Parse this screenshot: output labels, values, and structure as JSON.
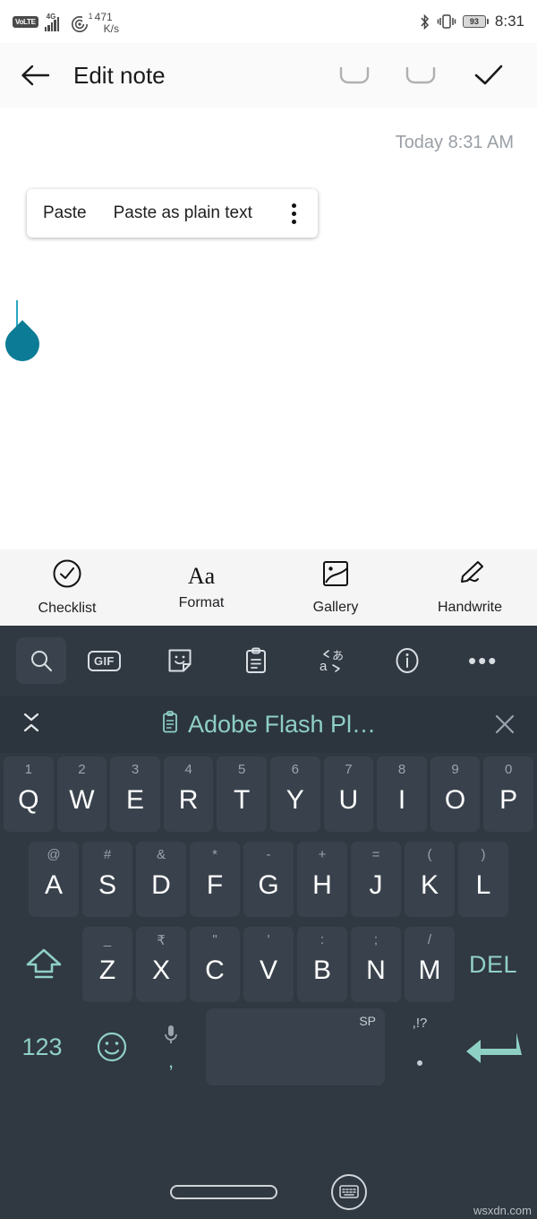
{
  "statusbar": {
    "volte": "VoLTE",
    "network_gen": "4G",
    "wifi_count": "1",
    "data_rate_value": "471",
    "data_rate_unit": "K/s",
    "battery_percent": "93",
    "clock": "8:31",
    "icons": [
      "volte-icon",
      "signal-bars-icon",
      "hotspot-icon",
      "bluetooth-icon",
      "vibrate-icon",
      "battery-icon"
    ]
  },
  "appbar": {
    "back_icon": "back-arrow-icon",
    "title": "Edit note",
    "undo_icon": "undo-icon",
    "redo_icon": "redo-icon",
    "done_icon": "checkmark-icon"
  },
  "note": {
    "timestamp": "Today 8:31 AM",
    "body_text": "",
    "paste_menu": {
      "paste_label": "Paste",
      "paste_plain_label": "Paste as plain text",
      "overflow_icon": "more-vertical-icon"
    },
    "cursor_handle_color": "#0c7b96"
  },
  "format_toolbar": {
    "items": [
      {
        "label": "Checklist",
        "icon": "checklist-circle-icon"
      },
      {
        "label": "Format",
        "icon": "format-aa-icon",
        "glyph": "Aa"
      },
      {
        "label": "Gallery",
        "icon": "gallery-image-icon"
      },
      {
        "label": "Handwrite",
        "icon": "handwrite-pen-icon"
      }
    ]
  },
  "keyboard": {
    "background": "#303841",
    "accent": "#8fd0c4",
    "toolbar": [
      {
        "name": "search-icon",
        "selected": true
      },
      {
        "name": "gif-icon",
        "label": "GIF"
      },
      {
        "name": "sticker-icon"
      },
      {
        "name": "clipboard-icon"
      },
      {
        "name": "translate-icon"
      },
      {
        "name": "info-icon"
      },
      {
        "name": "more-horizontal-icon",
        "label": "•••"
      }
    ],
    "suggestion": {
      "collapse_icon": "collapse-chevrons-icon",
      "clip_icon": "clipboard-icon",
      "text": "Adobe Flash Pl…",
      "close_icon": "close-x-icon"
    },
    "row1": [
      {
        "key": "Q",
        "hint": "1"
      },
      {
        "key": "W",
        "hint": "2"
      },
      {
        "key": "E",
        "hint": "3"
      },
      {
        "key": "R",
        "hint": "4"
      },
      {
        "key": "T",
        "hint": "5"
      },
      {
        "key": "Y",
        "hint": "6"
      },
      {
        "key": "U",
        "hint": "7"
      },
      {
        "key": "I",
        "hint": "8"
      },
      {
        "key": "O",
        "hint": "9"
      },
      {
        "key": "P",
        "hint": "0"
      }
    ],
    "row2": [
      {
        "key": "A",
        "hint": "@"
      },
      {
        "key": "S",
        "hint": "#"
      },
      {
        "key": "D",
        "hint": "&"
      },
      {
        "key": "F",
        "hint": "*"
      },
      {
        "key": "G",
        "hint": "-"
      },
      {
        "key": "H",
        "hint": "+"
      },
      {
        "key": "J",
        "hint": "="
      },
      {
        "key": "K",
        "hint": "("
      },
      {
        "key": "L",
        "hint": ")"
      }
    ],
    "row3": {
      "shift_icon": "shift-caps-icon",
      "keys": [
        {
          "key": "Z",
          "hint": "_"
        },
        {
          "key": "X",
          "hint": "₹"
        },
        {
          "key": "C",
          "hint": "\""
        },
        {
          "key": "V",
          "hint": "'"
        },
        {
          "key": "B",
          "hint": ":"
        },
        {
          "key": "N",
          "hint": ";"
        },
        {
          "key": "M",
          "hint": "/"
        }
      ],
      "delete_label": "DEL"
    },
    "row4": {
      "numeric_label": "123",
      "emoji_icon": "emoji-smiley-icon",
      "mic_icon": "microphone-icon",
      "comma_label": ",",
      "space_label": "SP",
      "period_hint": ",!?",
      "period_label": ".",
      "enter_icon": "enter-arrow-icon"
    }
  },
  "navbar": {
    "home_icon": "home-pill-icon",
    "hide_keyboard_icon": "hide-keyboard-icon",
    "watermark": "wsxdn.com"
  }
}
